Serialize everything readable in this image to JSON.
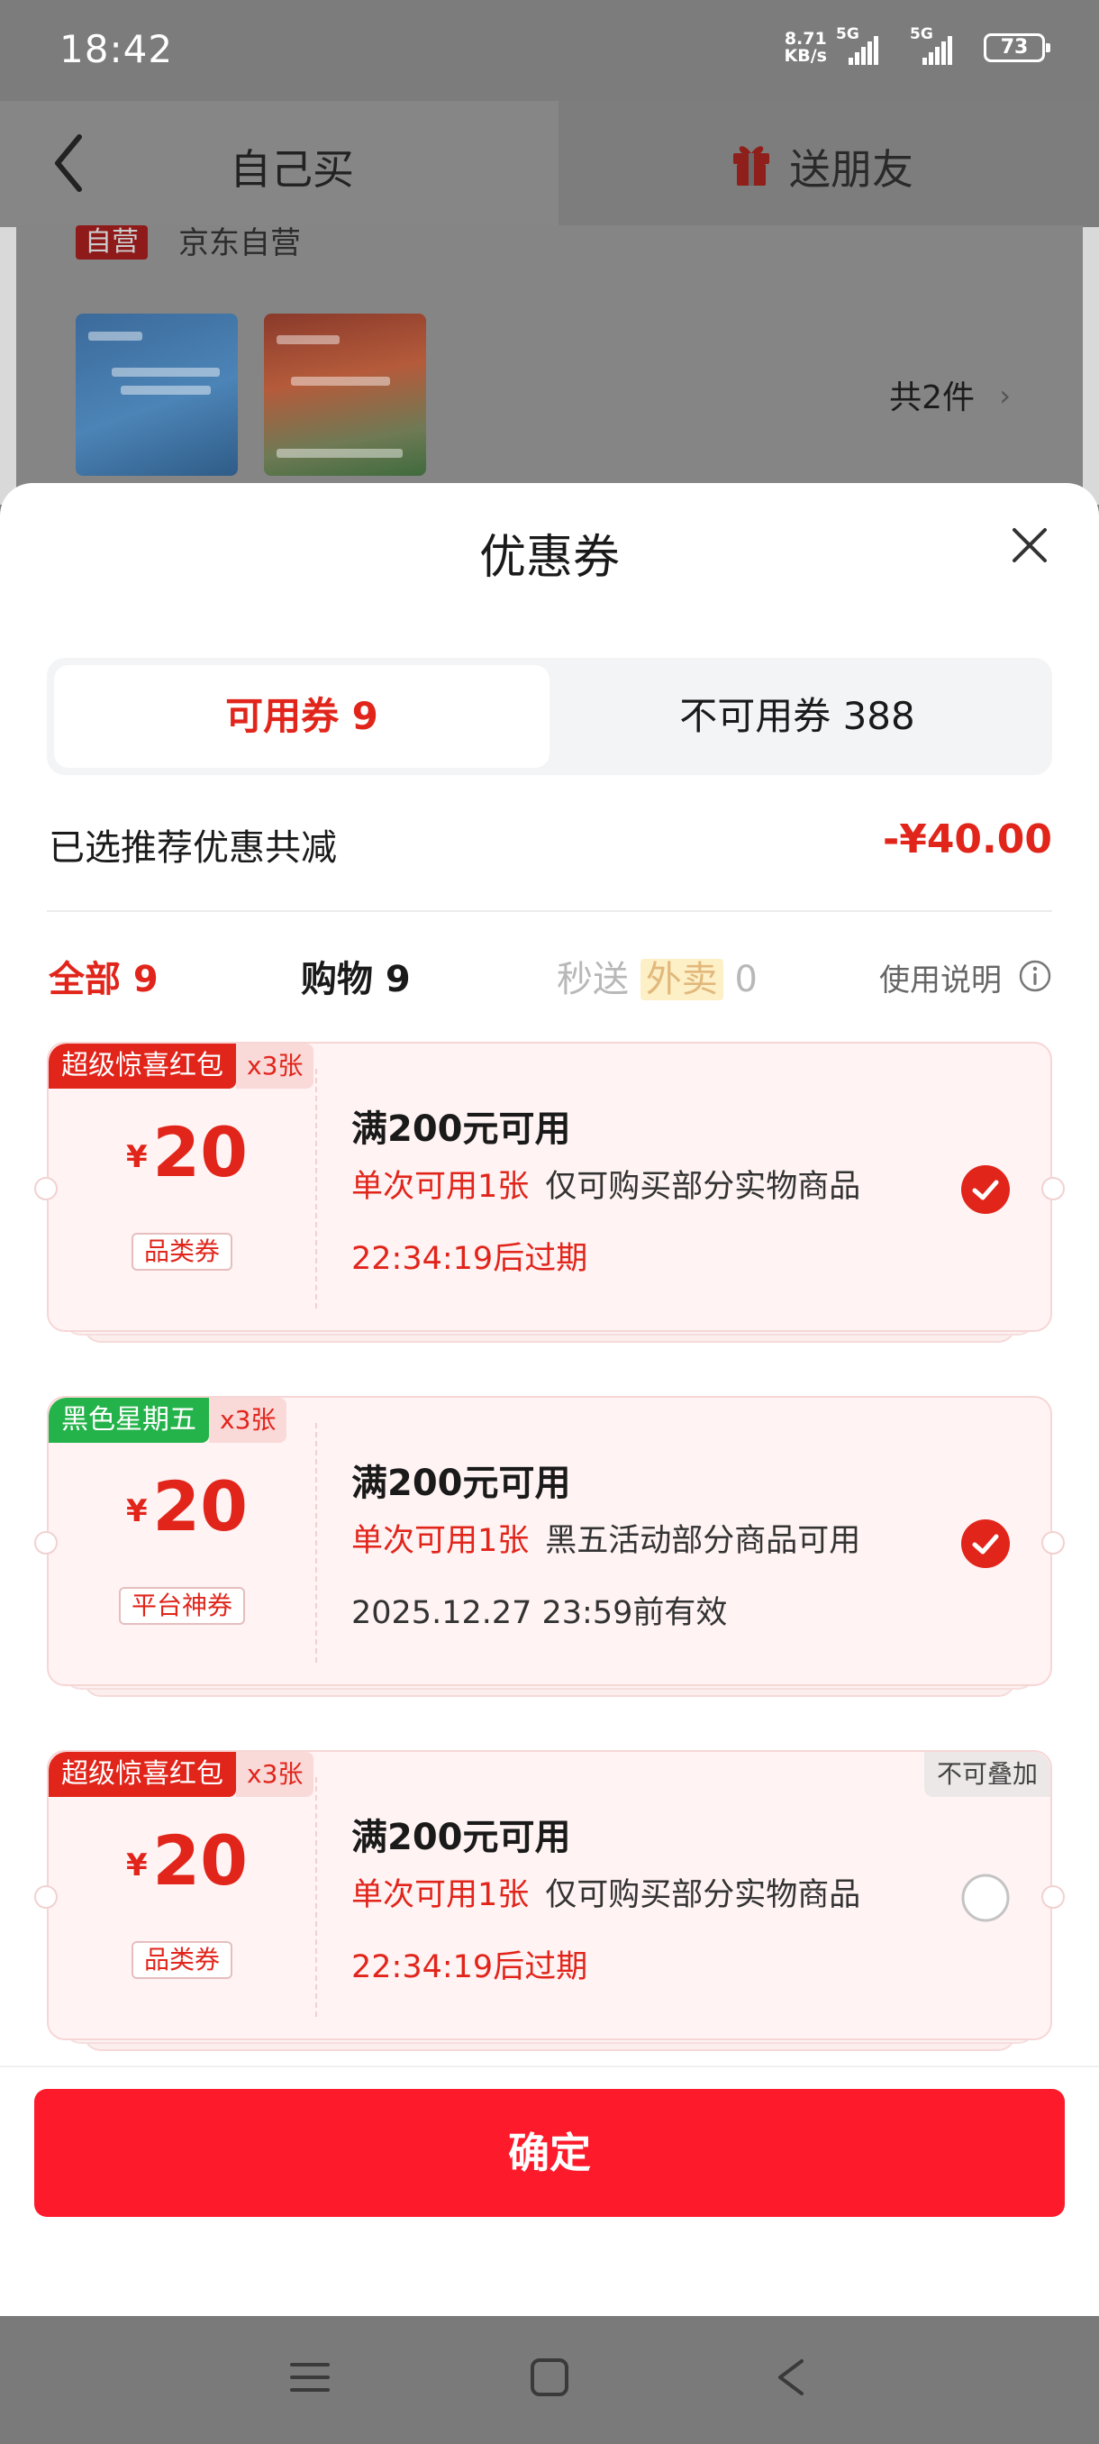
{
  "status_bar": {
    "time": "18:42",
    "net_speed_value": "8.71",
    "net_speed_unit": "KB/s",
    "sim1": "5G",
    "sim2": "5G",
    "battery": "73"
  },
  "nav": {
    "tab_self": "自己买",
    "tab_friend": "送朋友"
  },
  "order": {
    "self_tag": "自营",
    "shop_name": "京东自营",
    "total_count": "共2件"
  },
  "sheet": {
    "title": "优惠券",
    "segment_available": "可用券 9",
    "segment_unavailable": "不可用券 388",
    "saving_label": "已选推荐优惠共减",
    "saving_amount": "-¥40.00",
    "filters": {
      "all": "全部 9",
      "shopping": "购物 9",
      "fast_prefix": "秒送",
      "fast_tag": "外卖",
      "fast_count": "0",
      "help": "使用说明"
    },
    "coupons": [
      {
        "badge": "超级惊喜红包",
        "badge_color": "#e1251b",
        "count": "x3张",
        "currency": "¥",
        "value": "20",
        "type": "品类券",
        "title": "满200元可用",
        "limit": "单次可用1张",
        "scope": "仅可购买部分实物商品",
        "expire": "22:34:19后过期",
        "checked": true
      },
      {
        "badge": "黑色星期五",
        "badge_color": "#24b34a",
        "count": "x3张",
        "currency": "¥",
        "value": "20",
        "type": "平台神券",
        "title": "满200元可用",
        "limit": "单次可用1张",
        "scope": "黑五活动部分商品可用",
        "expire": "2025.12.27 23:59前有效",
        "checked": true
      },
      {
        "badge": "超级惊喜红包",
        "badge_color": "#e1251b",
        "count": "x3张",
        "currency": "¥",
        "value": "20",
        "type": "品类券",
        "title": "满200元可用",
        "limit": "单次可用1张",
        "scope": "仅可购买部分实物商品",
        "expire": "22:34:19后过期",
        "checked": false,
        "tag": "不可叠加"
      }
    ],
    "confirm": "确定"
  },
  "colors": {
    "accent": "#e1251b",
    "confirm": "#fd1a2a",
    "green": "#24b34a"
  },
  "icons": [
    "back-chevron-icon",
    "gift-icon",
    "close-icon",
    "info-icon",
    "check-circle-icon",
    "radio-empty-icon",
    "menu-icon",
    "home-square-icon",
    "back-triangle-icon"
  ]
}
